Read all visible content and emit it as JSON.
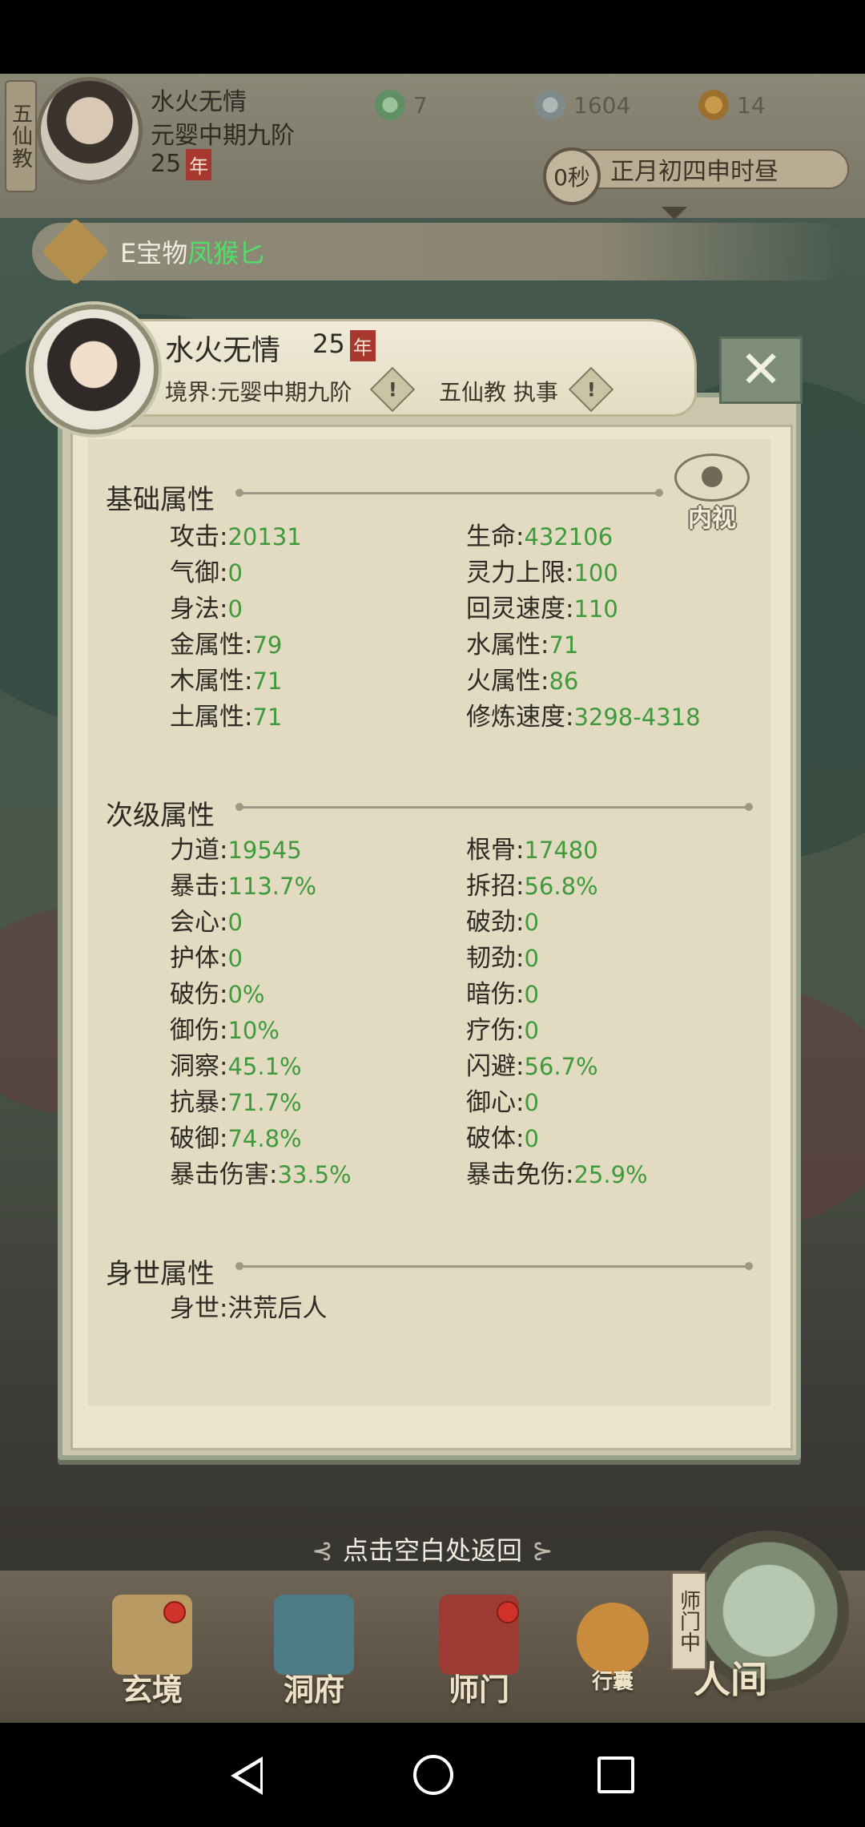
{
  "hud": {
    "sect_tab": "五仙教",
    "player_name": "水火无情",
    "realm": "元婴中期九阶",
    "age": "25",
    "age_unit": "年",
    "resources": [
      {
        "name": "jade-icon",
        "value": "7"
      },
      {
        "name": "coin-icon",
        "value": "1604"
      },
      {
        "name": "gourd-icon",
        "value": "14"
      }
    ],
    "timer": "0秒",
    "date": "正月初四申时昼"
  },
  "ticker": {
    "prefix": "E宝物",
    "highlight": "凤猴匕"
  },
  "panel": {
    "name": "水火无情",
    "age": "25",
    "age_unit": "年",
    "realm_label": "境界:元婴中期九阶",
    "title_label": "五仙教 执事",
    "warn_glyph": "!",
    "close_glyph": "✕",
    "view_label": "内视"
  },
  "sections": {
    "basic": {
      "title": "基础属性",
      "stats": [
        {
          "label": "攻击",
          "value": "20131"
        },
        {
          "label": "生命",
          "value": "432106"
        },
        {
          "label": "气御",
          "value": "0"
        },
        {
          "label": "灵力上限",
          "value": "100"
        },
        {
          "label": "身法",
          "value": "0"
        },
        {
          "label": "回灵速度",
          "value": "110"
        },
        {
          "label": "金属性",
          "value": "79"
        },
        {
          "label": "水属性",
          "value": "71"
        },
        {
          "label": "木属性",
          "value": "71"
        },
        {
          "label": "火属性",
          "value": "86"
        },
        {
          "label": "土属性",
          "value": "71"
        },
        {
          "label": "修炼速度",
          "value": "3298-4318"
        }
      ]
    },
    "secondary": {
      "title": "次级属性",
      "stats": [
        {
          "label": "力道",
          "value": "19545"
        },
        {
          "label": "根骨",
          "value": "17480"
        },
        {
          "label": "暴击",
          "value": "113.7%"
        },
        {
          "label": "拆招",
          "value": "56.8%"
        },
        {
          "label": "会心",
          "value": "0"
        },
        {
          "label": "破劲",
          "value": "0"
        },
        {
          "label": "护体",
          "value": "0"
        },
        {
          "label": "韧劲",
          "value": "0"
        },
        {
          "label": "破伤",
          "value": "0%"
        },
        {
          "label": "暗伤",
          "value": "0"
        },
        {
          "label": "御伤",
          "value": "10%"
        },
        {
          "label": "疗伤",
          "value": "0"
        },
        {
          "label": "洞察",
          "value": "45.1%"
        },
        {
          "label": "闪避",
          "value": "56.7%"
        },
        {
          "label": "抗暴",
          "value": "71.7%"
        },
        {
          "label": "御心",
          "value": "0"
        },
        {
          "label": "破御",
          "value": "74.8%"
        },
        {
          "label": "破体",
          "value": "0"
        },
        {
          "label": "暴击伤害",
          "value": "33.5%"
        },
        {
          "label": "暴击免伤",
          "value": "25.9%"
        }
      ]
    },
    "origin": {
      "title": "身世属性",
      "stats": [
        {
          "label": "身世",
          "value": "洪荒后人"
        }
      ]
    }
  },
  "colon": ":",
  "back_hint": "点击空白处返回",
  "bottom_nav": [
    {
      "label": "玄境"
    },
    {
      "label": "洞府"
    },
    {
      "label": "师门"
    },
    {
      "label": "行囊"
    }
  ],
  "world": {
    "badge": "师门中",
    "label": "人间"
  },
  "colors": {
    "value_green": "#3e9a3c",
    "ticker_highlight": "#4fe06a",
    "age_badge": "#a8372f"
  }
}
